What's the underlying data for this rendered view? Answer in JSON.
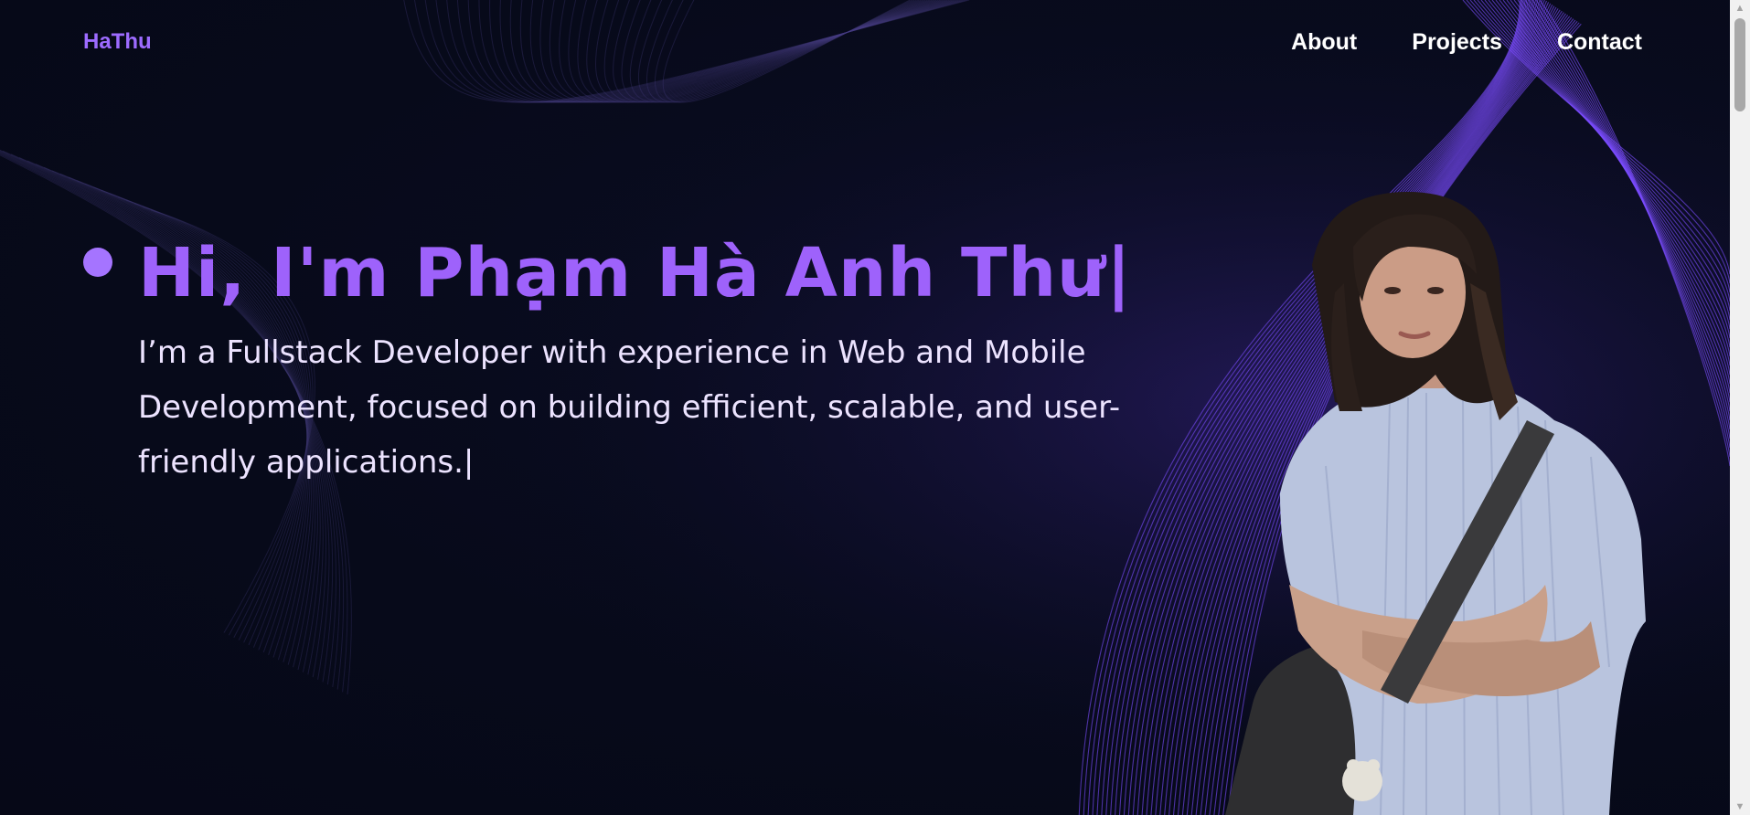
{
  "header": {
    "logo": "HaThu",
    "nav": {
      "about": "About",
      "projects": "Projects",
      "contact": "Contact"
    }
  },
  "hero": {
    "title": "Hi, I'm Phạm Hà Anh Thư|",
    "description": "I’m a Fullstack Developer with experience in Web and Mobile Development, focused on building efficient, scalable, and user-friendly applications.|"
  },
  "colors": {
    "background": "#070a1a",
    "accent": "#9e62fb",
    "text": "#ece3ff"
  },
  "icons": {
    "scroll_up": "triangle-up-icon",
    "scroll_down": "triangle-down-icon"
  }
}
